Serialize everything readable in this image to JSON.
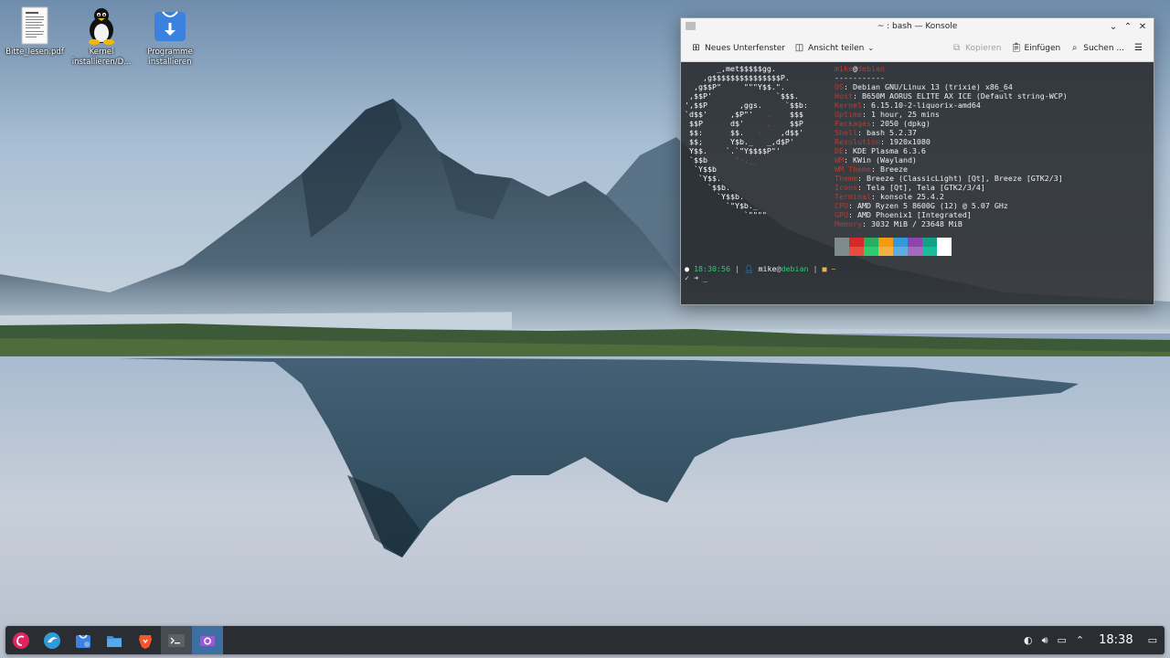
{
  "desktop": {
    "icons": [
      {
        "label": "Bitte_lesen.pdf",
        "icon": "pdf-document-icon"
      },
      {
        "label": "Kernel installieren/D...",
        "icon": "tux-linux-icon"
      },
      {
        "label": "Programme installieren",
        "icon": "download-installer-icon"
      }
    ]
  },
  "konsole": {
    "title": "~ : bash — Konsole",
    "toolbar": {
      "new_tab": "Neues Unterfenster",
      "split_view": "Ansicht teilen",
      "copy": "Kopieren",
      "paste": "Einfügen",
      "find": "Suchen ..."
    },
    "fastfetch": {
      "user": "mike",
      "host": "debian",
      "separator": "-----------",
      "rows": [
        {
          "key": "OS",
          "value": "Debian GNU/Linux 13 (trixie) x86_64"
        },
        {
          "key": "Host",
          "value": "B650M AORUS ELITE AX ICE (Default string-WCP)"
        },
        {
          "key": "Kernel",
          "value": "6.15.10-2-liquorix-amd64"
        },
        {
          "key": "Uptime",
          "value": "1 hour, 25 mins"
        },
        {
          "key": "Packages",
          "value": "2050 (dpkg)"
        },
        {
          "key": "Shell",
          "value": "bash 5.2.37"
        },
        {
          "key": "Resolution",
          "value": "1920x1080"
        },
        {
          "key": "DE",
          "value": "KDE Plasma 6.3.6"
        },
        {
          "key": "WM",
          "value": "KWin (Wayland)"
        },
        {
          "key": "WM Theme",
          "value": "Breeze"
        },
        {
          "key": "Theme",
          "value": "Breeze (ClassicLight) [Qt], Breeze [GTK2/3]"
        },
        {
          "key": "Icons",
          "value": "Tela [Qt], Tela [GTK2/3/4]"
        },
        {
          "key": "Terminal",
          "value": "konsole 25.4.2"
        },
        {
          "key": "CPU",
          "value": "AMD Ryzen 5 8600G (12) @ 5.07 GHz"
        },
        {
          "key": "GPU",
          "value": "AMD Phoenix1 [Integrated]"
        },
        {
          "key": "Memory",
          "value": "3032 MiB / 23648 MiB"
        }
      ],
      "palette": [
        "#7f8c8d",
        "#d62828",
        "#27ae60",
        "#f39c12",
        "#3498db",
        "#8e44ad",
        "#16a085",
        "#ffffff"
      ],
      "palette_bright": [
        "#7f8c8d",
        "#e74c3c",
        "#2ecc71",
        "#f5b041",
        "#5dade2",
        "#a569bd",
        "#1abc9c",
        "#ffffff"
      ]
    },
    "prompt": {
      "time": "18:30:56",
      "user": "mike",
      "host": "debian",
      "dir": "~",
      "line2": "✓ ➜ _"
    }
  },
  "taskbar": {
    "apps": [
      {
        "name": "debian-menu-icon"
      },
      {
        "name": "browser-icon"
      },
      {
        "name": "discover-store-icon"
      },
      {
        "name": "dolphin-files-icon"
      },
      {
        "name": "brave-browser-icon"
      },
      {
        "name": "konsole-terminal-icon"
      },
      {
        "name": "spectacle-screenshot-icon"
      }
    ],
    "clock": "18:38"
  }
}
